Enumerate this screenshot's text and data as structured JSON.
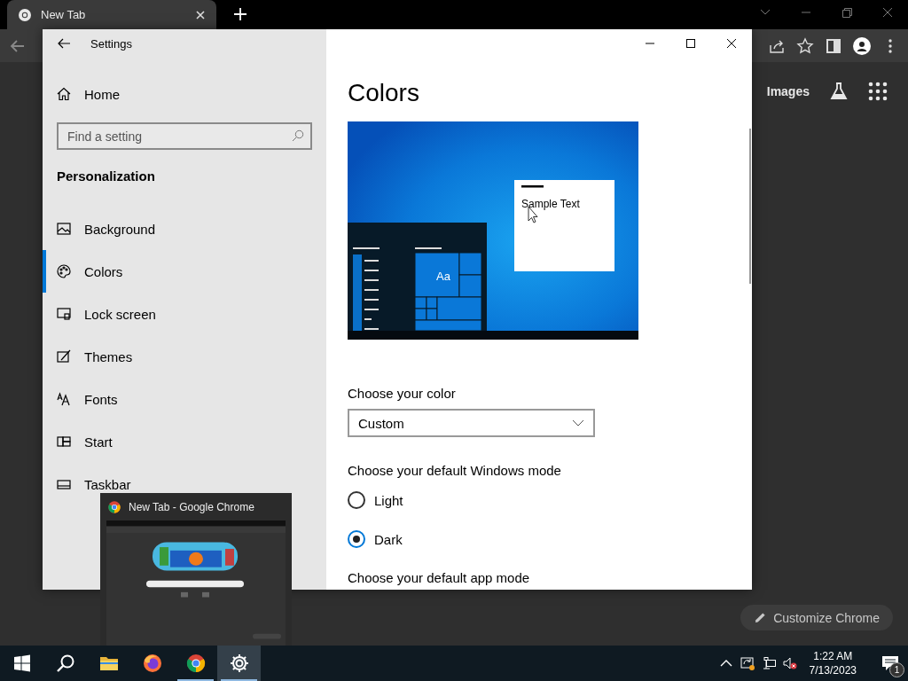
{
  "browser": {
    "tab": {
      "title": "New Tab"
    },
    "links": [
      "Images"
    ],
    "customize_button": "Customize Chrome"
  },
  "settings": {
    "title": "Settings",
    "home": "Home",
    "search": {
      "placeholder": "Find a setting"
    },
    "section": "Personalization",
    "items": [
      {
        "label": "Background",
        "selected": false
      },
      {
        "label": "Colors",
        "selected": true
      },
      {
        "label": "Lock screen",
        "selected": false
      },
      {
        "label": "Themes",
        "selected": false
      },
      {
        "label": "Fonts",
        "selected": false
      },
      {
        "label": "Start",
        "selected": false
      },
      {
        "label": "Taskbar",
        "selected": false
      }
    ],
    "page_title": "Colors",
    "preview": {
      "sample_text": "Sample Text",
      "tile_text": "Aa"
    },
    "color_label": "Choose your color",
    "color_value": "Custom",
    "mode_label": "Choose your default Windows mode",
    "modes": [
      {
        "label": "Light",
        "selected": false
      },
      {
        "label": "Dark",
        "selected": true
      }
    ],
    "app_mode_label": "Choose your default app mode"
  },
  "thumbnail_popup": {
    "title": "New Tab - Google Chrome"
  },
  "taskbar": {
    "apps": [
      {
        "running": false,
        "active": false
      },
      {
        "running": false,
        "active": false
      },
      {
        "running": true,
        "active": false
      },
      {
        "running": true,
        "active": true
      }
    ],
    "time": "1:22 AM",
    "date": "7/13/2023",
    "notification_count": "1"
  }
}
